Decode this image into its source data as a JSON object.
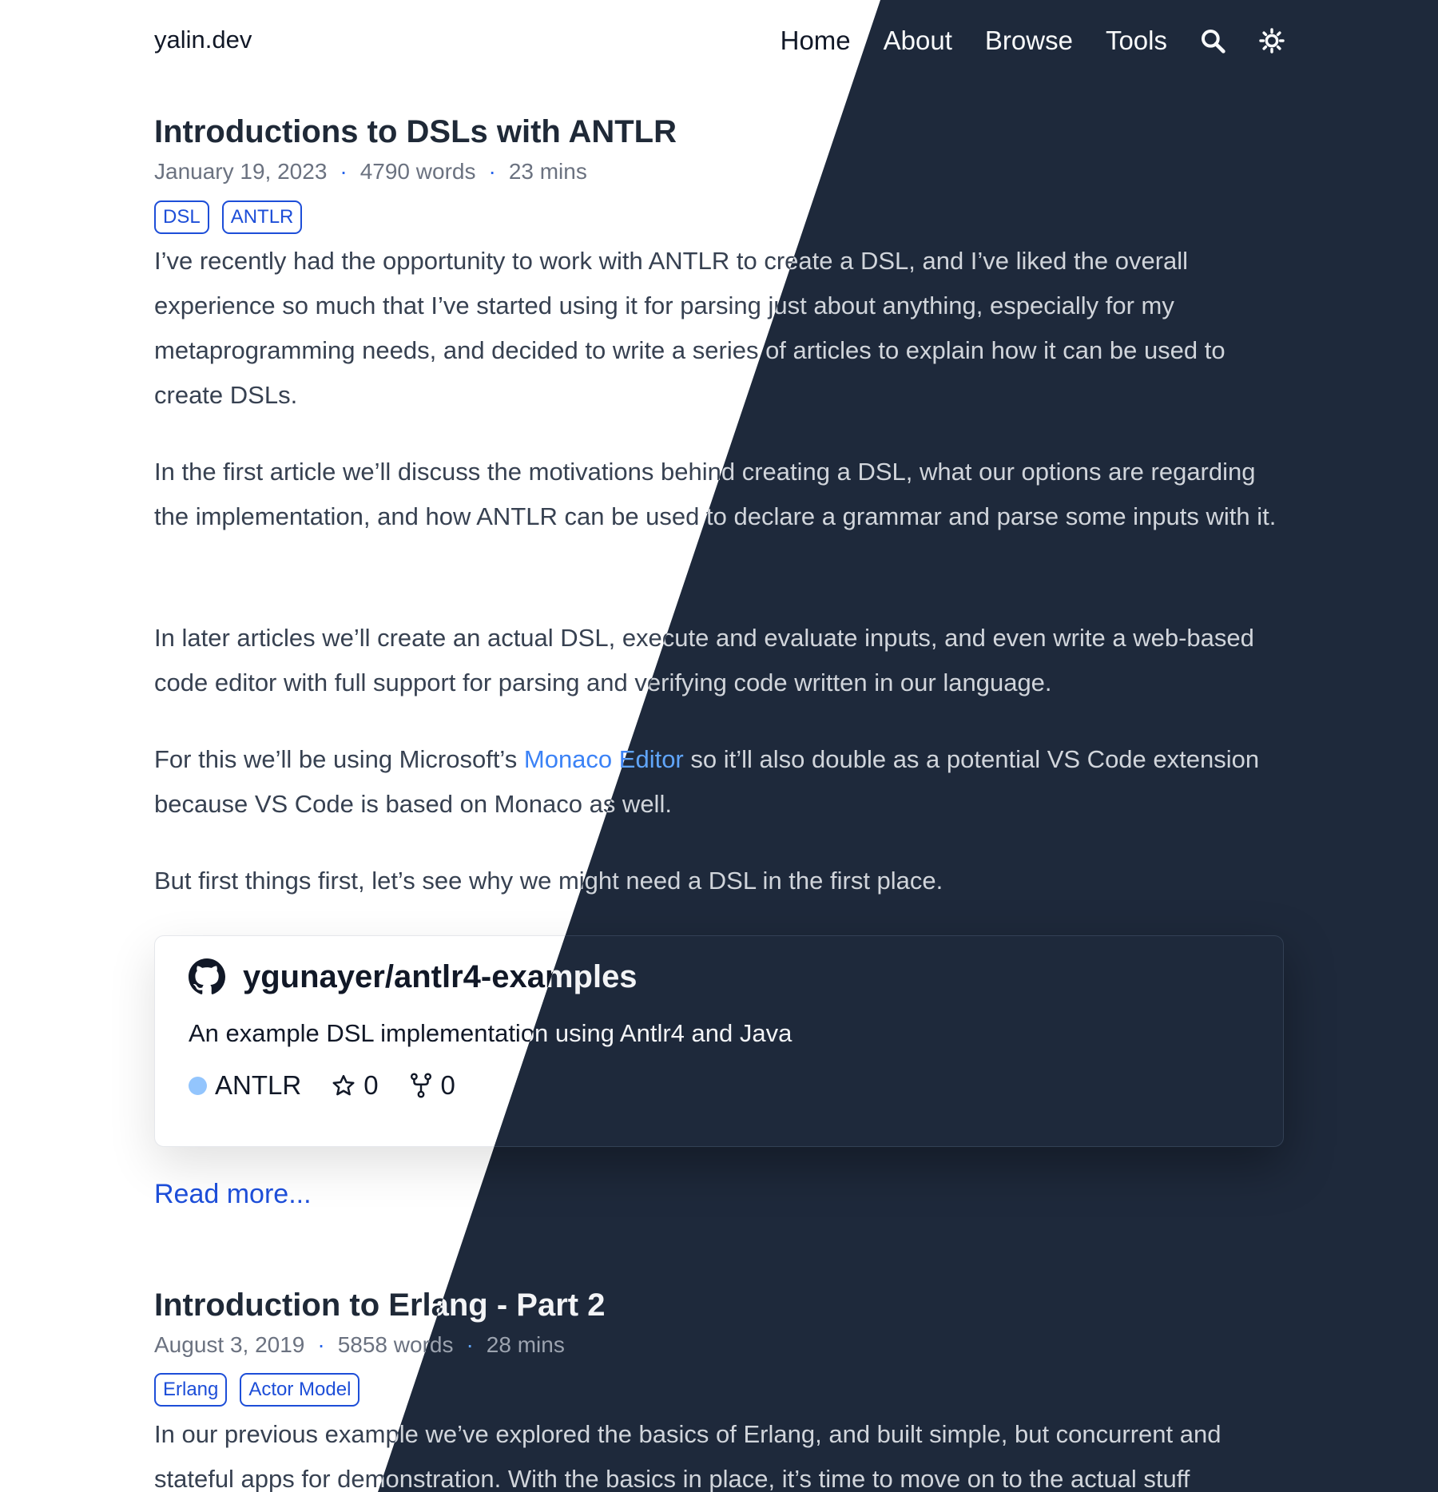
{
  "site": {
    "title": "yalin.dev",
    "nav": [
      "Home",
      "About",
      "Browse",
      "Tools"
    ],
    "icons": [
      "search-icon",
      "sun-icon"
    ]
  },
  "posts": [
    {
      "title": "Introductions to DSLs with ANTLR",
      "date": "January 19, 2023",
      "words": "4790 words",
      "time": "23 mins",
      "separator": "·",
      "tags": [
        "DSL",
        "ANTLR"
      ],
      "paragraphs": [
        "I’ve recently had the opportunity to work with ANTLR to create a DSL, and I’ve liked the overall experience so much that I’ve started using it for parsing just about anything, especially for my metaprogramming needs, and decided to write a series of articles to explain how it can be used to create DSLs.",
        "In the first article we’ll discuss the motivations behind creating a DSL, what our options are regarding the implementation, and how ANTLR can be used to declare a grammar and parse some inputs with it.",
        "In later articles we’ll create an actual DSL, execute and evaluate inputs, and even write a web-based code editor with full support for parsing and verifying code written in our language.",
        "But first things first, let’s see why we might need a DSL in the first place."
      ],
      "monaco_paragraph": {
        "before": "For this we’ll be using Microsoft’s ",
        "link": "Monaco Editor",
        "after": " so it’ll also double as a potential VS Code extension because VS Code is based on Monaco as well."
      },
      "repo": {
        "name": "ygunayer/antlr4-examples",
        "description": "An example DSL implementation using Antlr4 and Java",
        "language": "ANTLR",
        "language_color": "#93c5fd",
        "stars": "0",
        "forks": "0"
      },
      "read_more": "Read more..."
    },
    {
      "title": "Introduction to Erlang - Part 2",
      "date": "August 3, 2019",
      "words": "5858 words",
      "time": "28 mins",
      "separator": "·",
      "tags": [
        "Erlang",
        "Actor Model"
      ],
      "paragraphs": [
        "In our previous example we’ve explored the basics of Erlang, and built simple, but concurrent and stateful apps for demonstration. With the basics in place, it’s time to move on to the actual stuff"
      ]
    }
  ],
  "colors": {
    "light_bg": "#ffffff",
    "dark_bg": "#1e293b",
    "accent": "#1d4ed8",
    "link": "#3b82f6"
  }
}
